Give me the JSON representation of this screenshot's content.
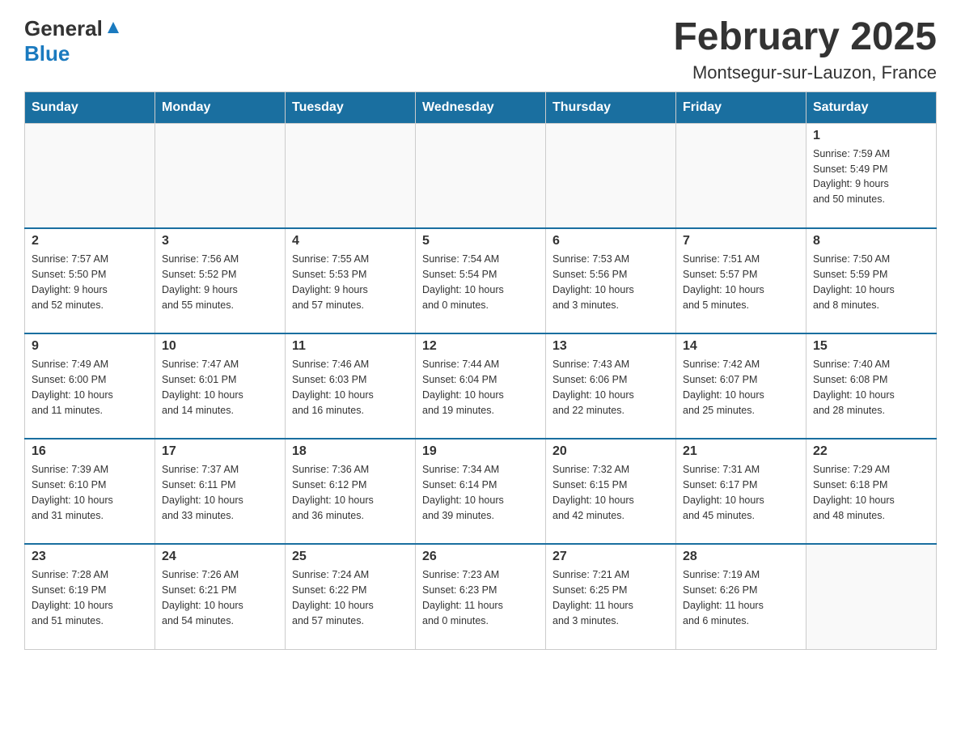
{
  "header": {
    "logo_general": "General",
    "logo_blue": "Blue",
    "month_title": "February 2025",
    "location": "Montsegur-sur-Lauzon, France"
  },
  "weekdays": [
    "Sunday",
    "Monday",
    "Tuesday",
    "Wednesday",
    "Thursday",
    "Friday",
    "Saturday"
  ],
  "weeks": [
    [
      {
        "day": "",
        "info": ""
      },
      {
        "day": "",
        "info": ""
      },
      {
        "day": "",
        "info": ""
      },
      {
        "day": "",
        "info": ""
      },
      {
        "day": "",
        "info": ""
      },
      {
        "day": "",
        "info": ""
      },
      {
        "day": "1",
        "info": "Sunrise: 7:59 AM\nSunset: 5:49 PM\nDaylight: 9 hours\nand 50 minutes."
      }
    ],
    [
      {
        "day": "2",
        "info": "Sunrise: 7:57 AM\nSunset: 5:50 PM\nDaylight: 9 hours\nand 52 minutes."
      },
      {
        "day": "3",
        "info": "Sunrise: 7:56 AM\nSunset: 5:52 PM\nDaylight: 9 hours\nand 55 minutes."
      },
      {
        "day": "4",
        "info": "Sunrise: 7:55 AM\nSunset: 5:53 PM\nDaylight: 9 hours\nand 57 minutes."
      },
      {
        "day": "5",
        "info": "Sunrise: 7:54 AM\nSunset: 5:54 PM\nDaylight: 10 hours\nand 0 minutes."
      },
      {
        "day": "6",
        "info": "Sunrise: 7:53 AM\nSunset: 5:56 PM\nDaylight: 10 hours\nand 3 minutes."
      },
      {
        "day": "7",
        "info": "Sunrise: 7:51 AM\nSunset: 5:57 PM\nDaylight: 10 hours\nand 5 minutes."
      },
      {
        "day": "8",
        "info": "Sunrise: 7:50 AM\nSunset: 5:59 PM\nDaylight: 10 hours\nand 8 minutes."
      }
    ],
    [
      {
        "day": "9",
        "info": "Sunrise: 7:49 AM\nSunset: 6:00 PM\nDaylight: 10 hours\nand 11 minutes."
      },
      {
        "day": "10",
        "info": "Sunrise: 7:47 AM\nSunset: 6:01 PM\nDaylight: 10 hours\nand 14 minutes."
      },
      {
        "day": "11",
        "info": "Sunrise: 7:46 AM\nSunset: 6:03 PM\nDaylight: 10 hours\nand 16 minutes."
      },
      {
        "day": "12",
        "info": "Sunrise: 7:44 AM\nSunset: 6:04 PM\nDaylight: 10 hours\nand 19 minutes."
      },
      {
        "day": "13",
        "info": "Sunrise: 7:43 AM\nSunset: 6:06 PM\nDaylight: 10 hours\nand 22 minutes."
      },
      {
        "day": "14",
        "info": "Sunrise: 7:42 AM\nSunset: 6:07 PM\nDaylight: 10 hours\nand 25 minutes."
      },
      {
        "day": "15",
        "info": "Sunrise: 7:40 AM\nSunset: 6:08 PM\nDaylight: 10 hours\nand 28 minutes."
      }
    ],
    [
      {
        "day": "16",
        "info": "Sunrise: 7:39 AM\nSunset: 6:10 PM\nDaylight: 10 hours\nand 31 minutes."
      },
      {
        "day": "17",
        "info": "Sunrise: 7:37 AM\nSunset: 6:11 PM\nDaylight: 10 hours\nand 33 minutes."
      },
      {
        "day": "18",
        "info": "Sunrise: 7:36 AM\nSunset: 6:12 PM\nDaylight: 10 hours\nand 36 minutes."
      },
      {
        "day": "19",
        "info": "Sunrise: 7:34 AM\nSunset: 6:14 PM\nDaylight: 10 hours\nand 39 minutes."
      },
      {
        "day": "20",
        "info": "Sunrise: 7:32 AM\nSunset: 6:15 PM\nDaylight: 10 hours\nand 42 minutes."
      },
      {
        "day": "21",
        "info": "Sunrise: 7:31 AM\nSunset: 6:17 PM\nDaylight: 10 hours\nand 45 minutes."
      },
      {
        "day": "22",
        "info": "Sunrise: 7:29 AM\nSunset: 6:18 PM\nDaylight: 10 hours\nand 48 minutes."
      }
    ],
    [
      {
        "day": "23",
        "info": "Sunrise: 7:28 AM\nSunset: 6:19 PM\nDaylight: 10 hours\nand 51 minutes."
      },
      {
        "day": "24",
        "info": "Sunrise: 7:26 AM\nSunset: 6:21 PM\nDaylight: 10 hours\nand 54 minutes."
      },
      {
        "day": "25",
        "info": "Sunrise: 7:24 AM\nSunset: 6:22 PM\nDaylight: 10 hours\nand 57 minutes."
      },
      {
        "day": "26",
        "info": "Sunrise: 7:23 AM\nSunset: 6:23 PM\nDaylight: 11 hours\nand 0 minutes."
      },
      {
        "day": "27",
        "info": "Sunrise: 7:21 AM\nSunset: 6:25 PM\nDaylight: 11 hours\nand 3 minutes."
      },
      {
        "day": "28",
        "info": "Sunrise: 7:19 AM\nSunset: 6:26 PM\nDaylight: 11 hours\nand 6 minutes."
      },
      {
        "day": "",
        "info": ""
      }
    ]
  ]
}
